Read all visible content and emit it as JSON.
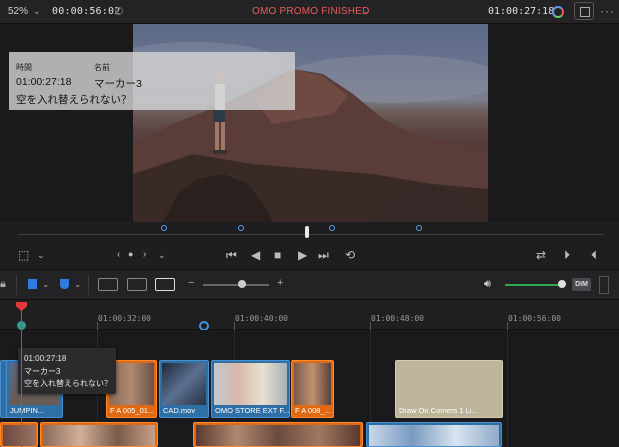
{
  "topbar": {
    "zoom": "52%",
    "zoom_arrow": "⌄",
    "source_timecode": "00:00:56:02",
    "title": "OMO PROMO FINISHED",
    "title_arrow": "⌄",
    "record_timecode": "01:00:27:18"
  },
  "overlay": {
    "time_label": "時間",
    "name_label": "名前",
    "time_value": "01:00:27:18",
    "name_value": "マーカー3",
    "note": "空を入れ替えられない？"
  },
  "ruler": {
    "ticks": [
      "01:00:32:00",
      "01:00:40:00",
      "01:00:48:00",
      "01:00:56:00"
    ]
  },
  "marker_popup": {
    "time": "01:00:27:18",
    "name": "マーカー3",
    "note": "空を入れ替えられない？"
  },
  "clips": {
    "c1": "JUMPIN...",
    "c2": "F A 005_01...",
    "c3": "CAD.mov",
    "c4": "OMO STORE EXT F...",
    "c5": "F A 008_...",
    "c6": "Draw On Corners 1 Li..."
  },
  "toolbar": {
    "dim_label": "DIM"
  },
  "colors": {
    "accent_blue": "#2f7de1",
    "title_red": "#e85b5b",
    "playhead_red": "#e23a3a",
    "clip_blue": "#2e6fa6",
    "clip_orange": "#e06a14",
    "clip_generator": "#bdb59a",
    "volume_green": "#2ea84a"
  }
}
